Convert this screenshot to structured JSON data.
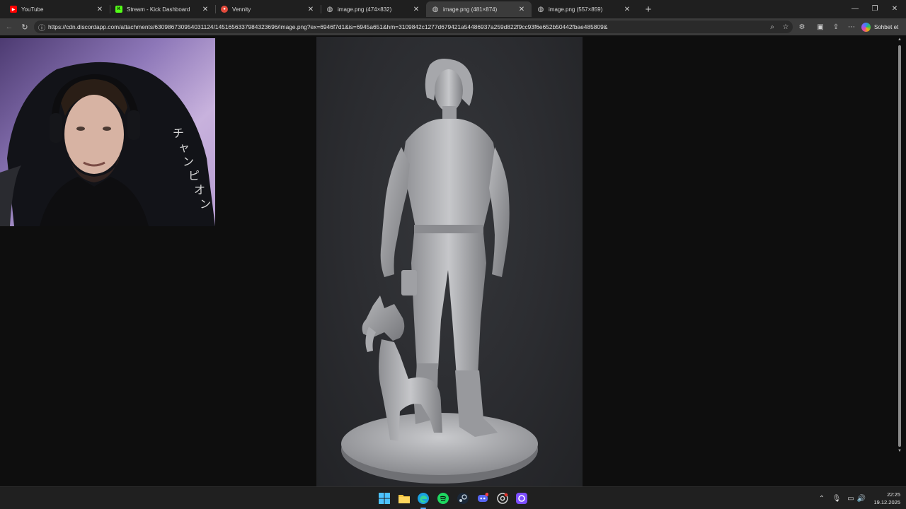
{
  "tabs": [
    {
      "title": "YouTube",
      "favicon": "youtube-icon",
      "favicon_color": "#ff0000",
      "active": false
    },
    {
      "title": "Stream - Kick Dashboard",
      "favicon": "kick-icon",
      "favicon_color": "#53fc18",
      "active": false
    },
    {
      "title": "Vennity",
      "favicon": "vennity-icon",
      "favicon_color": "#e34b3c",
      "active": false
    },
    {
      "title": "image.png (474×832)",
      "favicon": "globe-icon",
      "favicon_color": "#cfcfcf",
      "active": false
    },
    {
      "title": "image.png (481×874)",
      "favicon": "globe-icon",
      "favicon_color": "#cfcfcf",
      "active": true
    },
    {
      "title": "image.png (557×859)",
      "favicon": "globe-icon",
      "favicon_color": "#cfcfcf",
      "active": false
    }
  ],
  "address_bar": {
    "url": "https://cdn.discordapp.com/attachments/630986730954031124/1451656337984323696/image.png?ex=6946f7d1&is=6945a651&hm=3109842c1277d679421a54486937a259d822f9cc93f6e652b50442fbae485809&"
  },
  "copilot": {
    "label": "Sohbet et"
  },
  "taskbar": {
    "apps": [
      "windows-start-icon",
      "file-explorer-icon",
      "edge-icon",
      "spotify-icon",
      "steam-icon",
      "discord-icon",
      "chrome-icon",
      "app-icon"
    ],
    "clock": {
      "time": "22:25",
      "date": "19.12.2025"
    }
  },
  "colors": {
    "tab_strip": "#1f1f1f",
    "active_tab": "#3b3b3b",
    "viewport": "#0e0e0e",
    "taskbar": "#202020",
    "accent": "#5aa9ff"
  }
}
